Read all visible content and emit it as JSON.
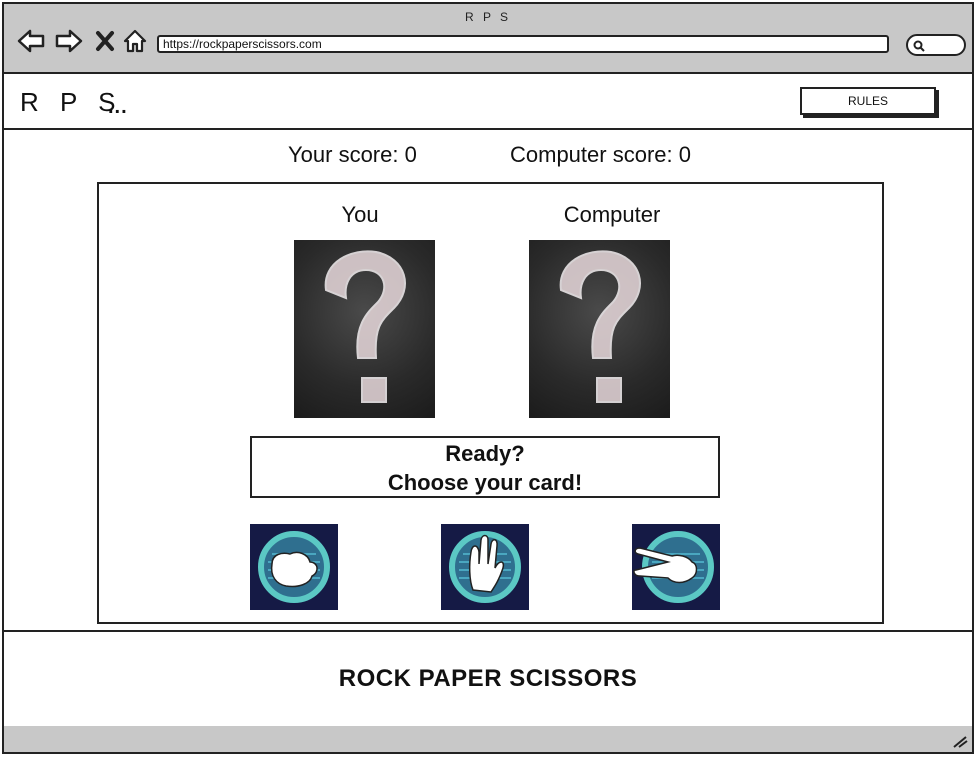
{
  "browser": {
    "window_title": "R P S",
    "url": "https://rockpaperscissors.com",
    "icons": [
      "back-arrow-icon",
      "forward-arrow-icon",
      "close-icon",
      "home-icon",
      "search-icon"
    ]
  },
  "header": {
    "brand": "R P S",
    "brand_suffix": "...",
    "rules_label": "RULES"
  },
  "scores": {
    "player": "Your score: 0",
    "computer": "Computer score: 0"
  },
  "game": {
    "player_label": "You",
    "computer_label": "Computer",
    "status_line1": "Ready?",
    "status_line2": "Choose your card!",
    "choices": [
      {
        "name": "rock",
        "icon": "fist-icon"
      },
      {
        "name": "paper",
        "icon": "open-hand-icon"
      },
      {
        "name": "scissors",
        "icon": "scissors-hand-icon"
      }
    ]
  },
  "footer": {
    "text": "ROCK PAPER SCISSORS"
  },
  "colors": {
    "chrome": "#c8c8c8",
    "choice_bg": "#151a45",
    "choice_ring": "#5bc8c4",
    "card_bg": "#2a2a2a"
  }
}
